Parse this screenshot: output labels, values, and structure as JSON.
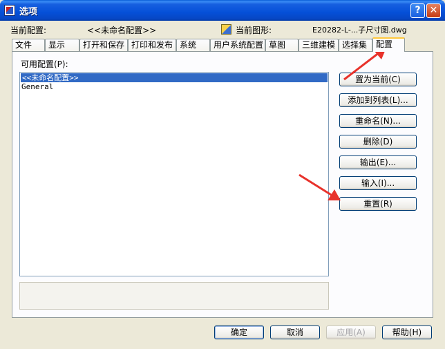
{
  "window": {
    "title": "选项"
  },
  "info": {
    "current_profile_label": "当前配置:",
    "current_profile_value": "<<未命名配置>>",
    "current_drawing_label": "当前图形:",
    "current_drawing_value": "E20282-L-...子尺寸图.dwg"
  },
  "tabs": [
    {
      "label": "文件"
    },
    {
      "label": "显示"
    },
    {
      "label": "打开和保存"
    },
    {
      "label": "打印和发布"
    },
    {
      "label": "系统"
    },
    {
      "label": "用户系统配置"
    },
    {
      "label": "草图"
    },
    {
      "label": "三维建模"
    },
    {
      "label": "选择集"
    },
    {
      "label": "配置",
      "active": true
    }
  ],
  "profiles": {
    "label": "可用配置(P):",
    "items": [
      "<<未命名配置>>",
      "General"
    ],
    "selected_index": 0
  },
  "side_buttons": {
    "set_current": "置为当前(C)",
    "add_to_list": "添加到列表(L)...",
    "rename": "重命名(N)...",
    "delete": "删除(D)",
    "export": "输出(E)...",
    "import": "输入(I)...",
    "reset": "重置(R)"
  },
  "footer": {
    "ok": "确定",
    "cancel": "取消",
    "apply": "应用(A)",
    "help": "帮助(H)"
  },
  "colors": {
    "titlebar": "#0a5fd8",
    "selection": "#316ac5",
    "active_tab_accent": "#ffc83c",
    "annotation_arrow": "#e8322b"
  },
  "icons": {
    "app": "autocad-app-icon",
    "drawing": "drawing-file-icon",
    "help": "help-icon",
    "close": "close-icon"
  }
}
